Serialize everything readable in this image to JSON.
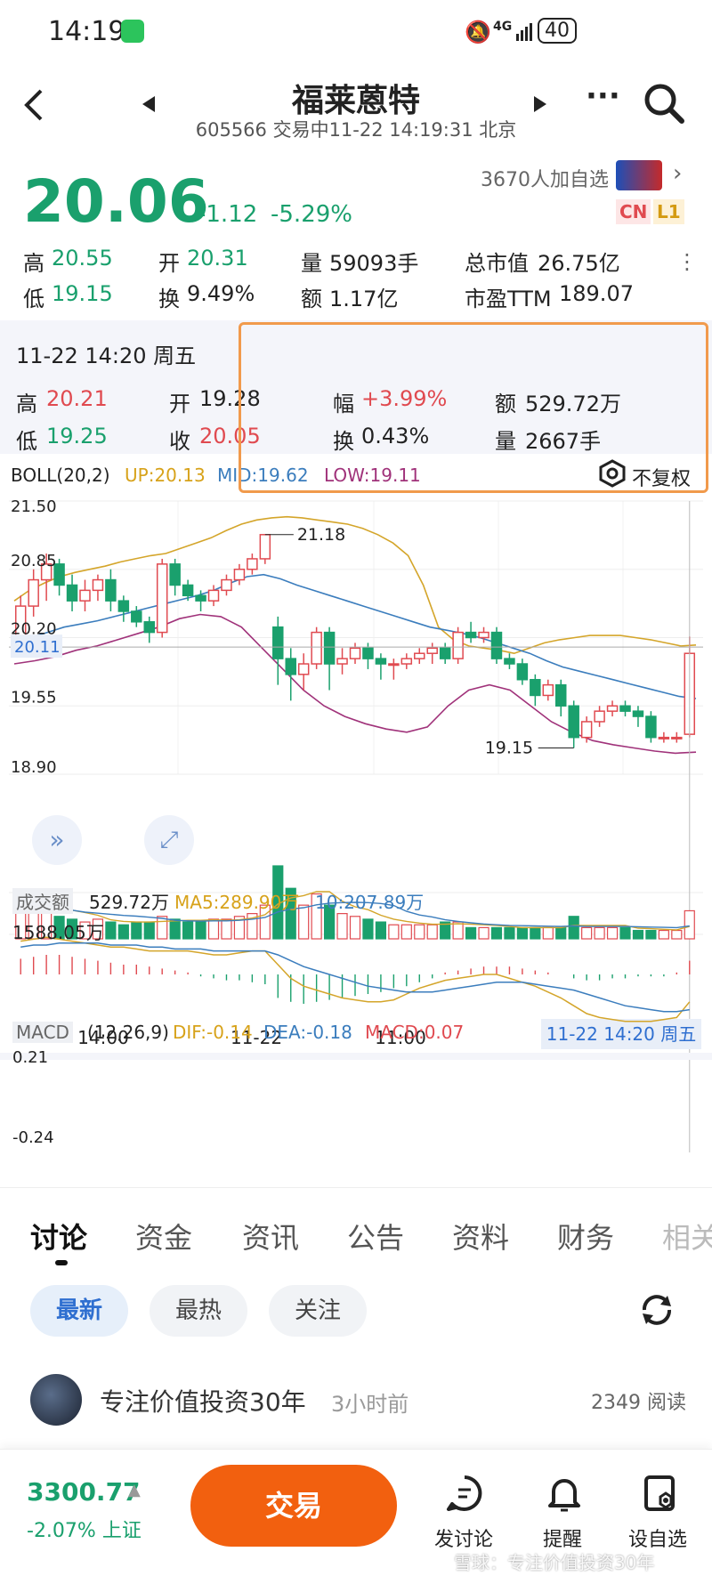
{
  "status_bar": {
    "time": "14:19",
    "network": "4G",
    "battery": "40"
  },
  "header": {
    "title": "福莱蒽特",
    "subtitle": "605566 交易中11-22 14:19:31 北京"
  },
  "quote": {
    "price": "20.06",
    "change": "-1.12",
    "change_pct": "-5.29%",
    "followers": "3670人加自选",
    "badge_cn": "CN",
    "badge_l1": "L1",
    "high_label": "高",
    "high": "20.55",
    "open_label": "开",
    "open": "20.31",
    "volume_label": "量",
    "volume": "59093手",
    "mktcap_label": "总市值",
    "mktcap": "26.75亿",
    "low_label": "低",
    "low": "19.15",
    "turnover_label": "换",
    "turnover": "9.49%",
    "amount_label": "额",
    "amount": "1.17亿",
    "pe_label": "市盈TTM",
    "pe": "189.07"
  },
  "detail": {
    "datetime": "11-22 14:20 周五",
    "high_label": "高",
    "high": "20.21",
    "open_label": "开",
    "open": "19.28",
    "amp_label": "幅",
    "amp": "+3.99%",
    "amount_label": "额",
    "amount": "529.72万",
    "low_label": "低",
    "low": "19.25",
    "close_label": "收",
    "close": "20.05",
    "turnover_label": "换",
    "turnover": "0.43%",
    "volume_label": "量",
    "volume": "2667手"
  },
  "boll": {
    "label": "BOLL(20,2)",
    "up": "UP:20.13",
    "mid": "MID:19.62",
    "low": "LOW:19.11",
    "adjust": "不复权"
  },
  "chart_data": {
    "type": "candlestick",
    "y_ticks": [
      "21.50",
      "20.85",
      "20.20",
      "19.55",
      "18.90"
    ],
    "ylim": [
      18.9,
      21.5
    ],
    "current_price_label": "20.11",
    "max_label": "21.18",
    "min_label": "19.15",
    "x_ticks": [
      "14:00",
      "11-22",
      "11:00"
    ],
    "cursor_label": "11-22 14:20 周五",
    "candles": [
      [
        20.2,
        20.5,
        20.15,
        20.6
      ],
      [
        20.5,
        20.75,
        20.4,
        20.85
      ],
      [
        20.75,
        20.9,
        20.55,
        21.0
      ],
      [
        20.9,
        20.7,
        20.6,
        20.95
      ],
      [
        20.7,
        20.55,
        20.45,
        20.8
      ],
      [
        20.55,
        20.65,
        20.45,
        20.75
      ],
      [
        20.65,
        20.75,
        20.55,
        20.8
      ],
      [
        20.75,
        20.55,
        20.45,
        20.85
      ],
      [
        20.55,
        20.45,
        20.35,
        20.6
      ],
      [
        20.45,
        20.35,
        20.3,
        20.5
      ],
      [
        20.35,
        20.25,
        20.15,
        20.4
      ],
      [
        20.25,
        20.9,
        20.2,
        20.95
      ],
      [
        20.9,
        20.7,
        20.6,
        20.95
      ],
      [
        20.7,
        20.6,
        20.55,
        20.75
      ],
      [
        20.6,
        20.55,
        20.45,
        20.65
      ],
      [
        20.55,
        20.65,
        20.5,
        20.7
      ],
      [
        20.65,
        20.75,
        20.6,
        20.8
      ],
      [
        20.75,
        20.85,
        20.7,
        20.9
      ],
      [
        20.85,
        20.95,
        20.8,
        21.0
      ],
      [
        20.95,
        21.18,
        20.9,
        21.18
      ],
      [
        20.3,
        20.0,
        19.75,
        20.4
      ],
      [
        20.0,
        19.85,
        19.6,
        20.1
      ],
      [
        19.85,
        19.95,
        19.7,
        20.05
      ],
      [
        19.95,
        20.25,
        19.9,
        20.3
      ],
      [
        20.25,
        19.95,
        19.7,
        20.3
      ],
      [
        19.95,
        20.0,
        19.85,
        20.1
      ],
      [
        20.0,
        20.1,
        19.95,
        20.15
      ],
      [
        20.1,
        20.0,
        19.9,
        20.15
      ],
      [
        20.0,
        19.95,
        19.8,
        20.05
      ],
      [
        19.95,
        19.95,
        19.8,
        20.0
      ],
      [
        19.95,
        20.0,
        19.9,
        20.05
      ],
      [
        20.0,
        20.05,
        19.95,
        20.1
      ],
      [
        20.05,
        20.1,
        19.95,
        20.15
      ],
      [
        20.1,
        20.0,
        19.95,
        20.15
      ],
      [
        20.0,
        20.25,
        19.95,
        20.3
      ],
      [
        20.25,
        20.2,
        20.15,
        20.35
      ],
      [
        20.2,
        20.25,
        20.15,
        20.3
      ],
      [
        20.25,
        20.0,
        19.95,
        20.3
      ],
      [
        20.0,
        19.95,
        19.9,
        20.05
      ],
      [
        19.95,
        19.8,
        19.75,
        20.0
      ],
      [
        19.8,
        19.65,
        19.55,
        19.85
      ],
      [
        19.65,
        19.75,
        19.6,
        19.8
      ],
      [
        19.75,
        19.55,
        19.45,
        19.8
      ],
      [
        19.55,
        19.25,
        19.15,
        19.6
      ],
      [
        19.25,
        19.4,
        19.2,
        19.45
      ],
      [
        19.4,
        19.5,
        19.35,
        19.55
      ],
      [
        19.5,
        19.55,
        19.45,
        19.6
      ],
      [
        19.55,
        19.5,
        19.45,
        19.6
      ],
      [
        19.5,
        19.45,
        19.35,
        19.55
      ],
      [
        19.45,
        19.25,
        19.2,
        19.5
      ],
      [
        19.25,
        19.25,
        19.2,
        19.3
      ],
      [
        19.25,
        19.25,
        19.2,
        19.3
      ],
      [
        19.28,
        20.05,
        19.25,
        20.21
      ]
    ],
    "boll_up": [
      20.55,
      20.65,
      20.72,
      20.78,
      20.82,
      20.85,
      20.88,
      20.92,
      20.95,
      20.98,
      21.0,
      21.05,
      21.1,
      21.15,
      21.22,
      21.28,
      21.32,
      21.34,
      21.35,
      21.34,
      21.32,
      21.3,
      21.28,
      21.24,
      21.18,
      21.1,
      20.98,
      20.7,
      20.3,
      20.18,
      20.12,
      20.1,
      20.08,
      20.05,
      20.1,
      20.15,
      20.18,
      20.2,
      20.22,
      20.22,
      20.22,
      20.2,
      20.18,
      20.15,
      20.12,
      20.13
    ],
    "boll_mid": [
      20.15,
      20.2,
      20.25,
      20.3,
      20.33,
      20.36,
      20.4,
      20.44,
      20.48,
      20.52,
      20.56,
      20.6,
      20.65,
      20.72,
      20.78,
      20.8,
      20.76,
      20.7,
      20.65,
      20.6,
      20.55,
      20.5,
      20.45,
      20.4,
      20.35,
      20.3,
      20.27,
      20.24,
      20.2,
      20.15,
      20.1,
      20.05,
      19.98,
      19.92,
      19.88,
      19.84,
      19.8,
      19.76,
      19.72,
      19.68,
      19.64,
      19.62
    ],
    "boll_low": [
      19.95,
      19.98,
      20.02,
      20.08,
      20.12,
      20.18,
      20.24,
      20.3,
      20.38,
      20.42,
      20.4,
      20.3,
      20.1,
      19.9,
      19.7,
      19.55,
      19.45,
      19.38,
      19.33,
      19.3,
      19.35,
      19.55,
      19.7,
      19.75,
      19.7,
      19.55,
      19.4,
      19.3,
      19.22,
      19.18,
      19.15,
      19.12,
      19.1,
      19.11
    ],
    "volume_label": "成交额",
    "volume_value": "529.72万",
    "ma5": "MA5:289.90万",
    "ma10": "10:207.89万",
    "volume_max": "1588.05万",
    "volumes": [
      50,
      60,
      70,
      40,
      35,
      30,
      35,
      30,
      25,
      30,
      30,
      40,
      35,
      30,
      30,
      35,
      35,
      40,
      45,
      60,
      130,
      90,
      60,
      80,
      60,
      45,
      40,
      35,
      30,
      25,
      25,
      25,
      25,
      30,
      30,
      20,
      20,
      20,
      20,
      20,
      20,
      20,
      20,
      40,
      20,
      20,
      20,
      20,
      15,
      15,
      15,
      15,
      50
    ],
    "macd_label": "MACD",
    "macd_params": "(12,26,9)",
    "dif": "DIF:-0.14",
    "dea": "DEA:-0.18",
    "macd": "MACD:0.07",
    "macd_top": "0.21",
    "macd_bottom": "-0.24"
  },
  "tabs": [
    "讨论",
    "资金",
    "资讯",
    "公告",
    "资料",
    "财务",
    "相关"
  ],
  "filters": [
    "最新",
    "最热",
    "关注"
  ],
  "post": {
    "author": "专注价值投资30年",
    "time": "3小时前",
    "reads": "2349 阅读"
  },
  "bottom": {
    "index_value": "3300.77",
    "index_change": "-2.07% 上证",
    "trade": "交易",
    "discuss": "发讨论",
    "alert": "提醒",
    "watch": "设自选",
    "watermark": "雪球：专注价值投资30年"
  }
}
